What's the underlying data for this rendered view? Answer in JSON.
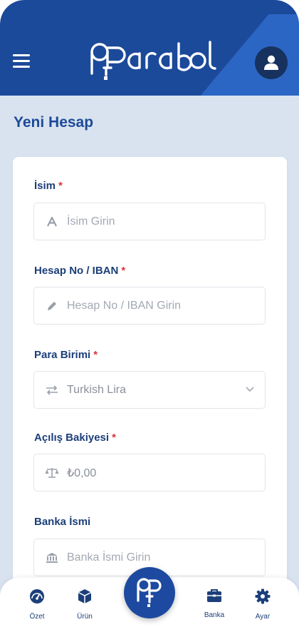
{
  "header": {
    "logo_text": "Parabol",
    "menu_icon": "hamburger-icon",
    "profile_icon": "user-icon",
    "colors": {
      "primary": "#1c4a9a",
      "accent": "#2c66c4",
      "background": "#d9e3ef",
      "required": "#d9363e"
    }
  },
  "page": {
    "title": "Yeni Hesap"
  },
  "form": {
    "name": {
      "label": "İsim",
      "required": "*",
      "placeholder": "İsim Girin",
      "icon": "text-icon"
    },
    "iban": {
      "label": "Hesap No / IBAN",
      "required": "*",
      "placeholder": "Hesap No / IBAN Girin",
      "icon": "pencil-icon"
    },
    "currency": {
      "label": "Para Birimi",
      "required": "*",
      "value": "Turkish Lira",
      "icon": "swap-icon"
    },
    "opening_balance": {
      "label": "Açılış Bakiyesi",
      "required": "*",
      "value": "₺0,00",
      "icon": "scale-icon"
    },
    "bank_name": {
      "label": "Banka İsmi",
      "placeholder": "Banka İsmi Girin",
      "icon": "bank-icon"
    }
  },
  "nav": {
    "items": [
      {
        "label": "Özet",
        "icon": "dashboard-icon"
      },
      {
        "label": "Ürün",
        "icon": "box-icon"
      },
      {
        "label": "Banka",
        "icon": "briefcase-icon"
      },
      {
        "label": "Ayar",
        "icon": "gear-icon"
      }
    ],
    "center_icon": "parabol-logo-icon"
  }
}
